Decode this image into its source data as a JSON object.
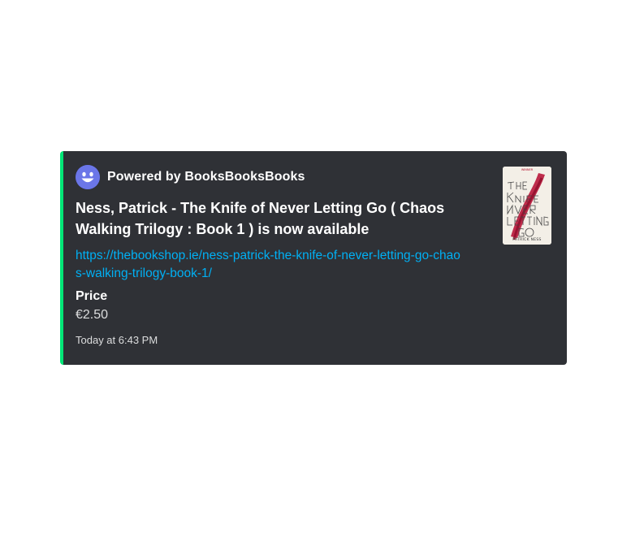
{
  "embed": {
    "accent_color": "#00e676",
    "background_color": "#2f3136",
    "author": {
      "name": "Powered by BooksBooksBooks",
      "avatar_icon": "smiley-face-icon"
    },
    "title": "Ness, Patrick  -  The Knife of Never Letting Go ( Chaos Walking Trilogy : Book 1 ) is now available",
    "url": "https://thebookshop.ie/ness-patrick-the-knife-of-never-letting-go-chaos-walking-trilogy-book-1/",
    "fields": [
      {
        "name": "Price",
        "value": "€2.50"
      }
    ],
    "footer": {
      "timestamp": "Today at 6:43 PM"
    },
    "thumbnail": {
      "cover_title": "The Knife of Never Letting Go",
      "cover_author": "PATRICK NESS",
      "cover_badge": "WINNER"
    }
  }
}
